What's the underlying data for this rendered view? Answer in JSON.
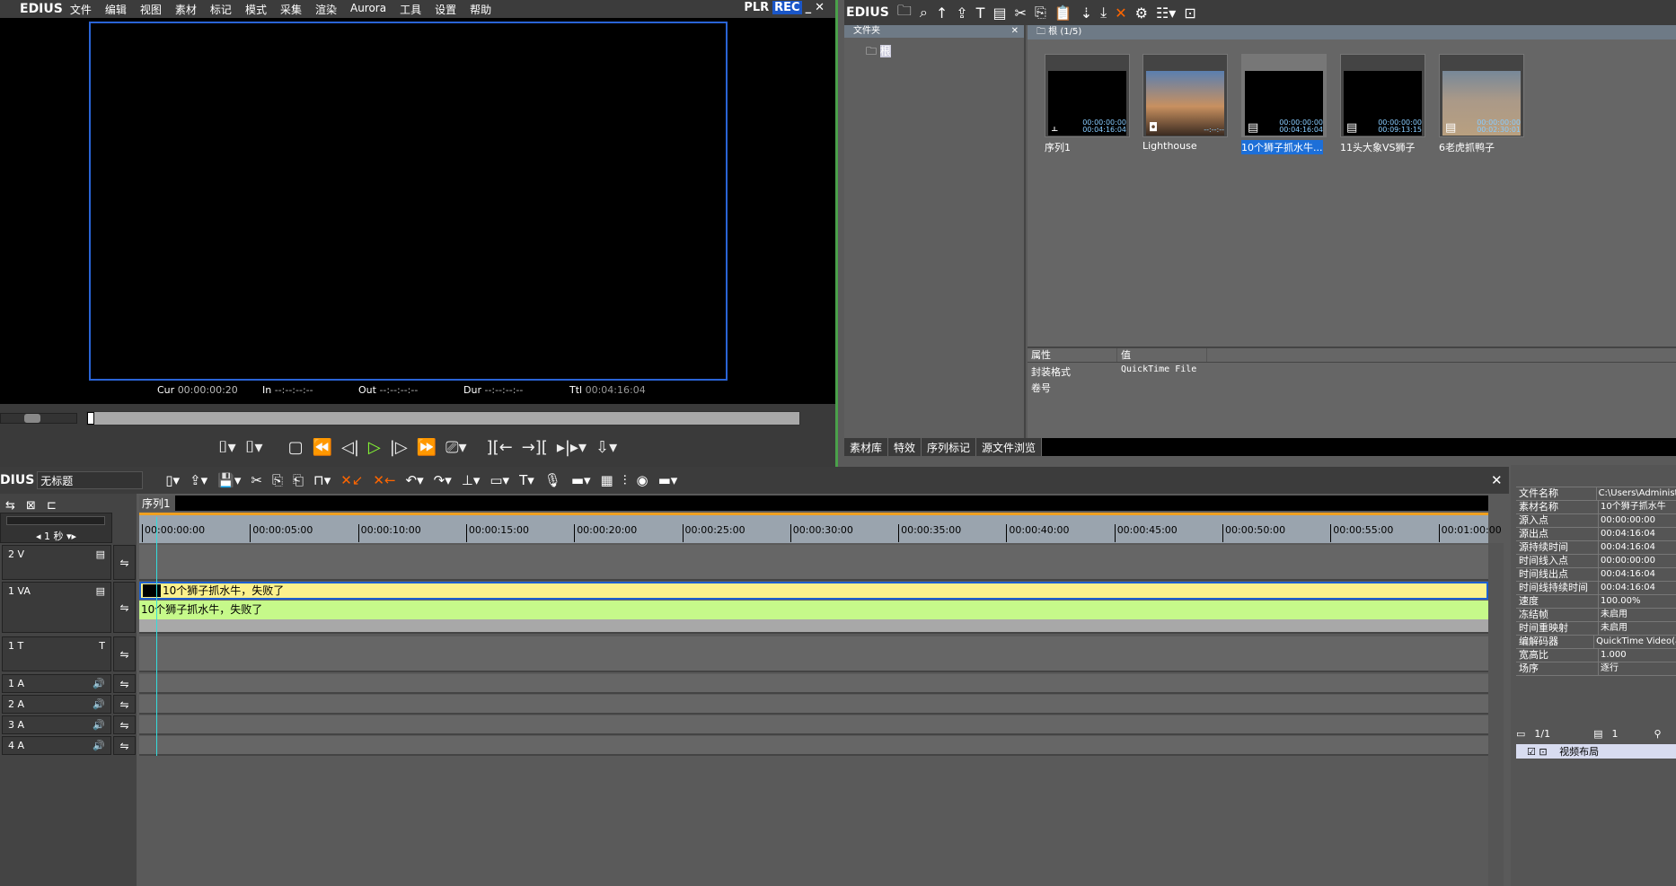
{
  "menu": {
    "logo": "EDIUS",
    "items": [
      "文件",
      "编辑",
      "视图",
      "素材",
      "标记",
      "模式",
      "采集",
      "渲染",
      "Aurora",
      "工具",
      "设置",
      "帮助"
    ],
    "plr": "PLR",
    "rec": "REC"
  },
  "player": {
    "cur_label": "Cur",
    "cur": "00:00:00:20",
    "in_label": "In",
    "in": "--:--:--:--",
    "out_label": "Out",
    "out": "--:--:--:--",
    "dur_label": "Dur",
    "dur": "--:--:--:--",
    "ttl_label": "Ttl",
    "ttl": "00:04:16:04"
  },
  "bin": {
    "logo": "EDIUS",
    "folder_title": "文件夹",
    "root": "根",
    "header": "根 (1/5)",
    "clips": [
      {
        "name": "序列1",
        "in": "00:00:00:00",
        "dur": "00:04:16:04",
        "icon": "sequence-icon"
      },
      {
        "name": "Lighthouse",
        "in": "",
        "dur": "--:--:--",
        "icon": "still-image-icon"
      },
      {
        "name": "10个狮子抓水牛...",
        "in": "00:00:00:00",
        "dur": "00:04:16:04",
        "icon": "film-icon",
        "selected": true
      },
      {
        "name": "11头大象VS狮子",
        "in": "00:00:00:00",
        "dur": "00:09:13:15",
        "icon": "film-icon"
      },
      {
        "name": "6老虎抓鸭子",
        "in": "00:00:00:00",
        "dur": "00:02:30:01",
        "icon": "film-icon"
      }
    ],
    "props_header": [
      "属性",
      "值"
    ],
    "props": [
      [
        "封装格式",
        "QuickTime File"
      ],
      [
        "卷号",
        ""
      ]
    ],
    "tabs": [
      "素材库",
      "特效",
      "序列标记",
      "源文件浏览"
    ]
  },
  "timeline": {
    "logo": "DIUS",
    "project": "无标题",
    "sequence_tab": "序列1",
    "scale": "1 秒",
    "ruler": [
      "00:00:00:00",
      "00:00:05:00",
      "00:00:10:00",
      "00:00:15:00",
      "00:00:20:00",
      "00:00:25:00",
      "00:00:30:00",
      "00:00:35:00",
      "00:00:40:00",
      "00:00:45:00",
      "00:00:50:00",
      "00:00:55:00",
      "00:01:00:00"
    ],
    "tracks": [
      "2 V",
      "1 VA",
      "1 T",
      "1 A",
      "2 A",
      "3 A",
      "4 A"
    ],
    "video_clip": "10个狮子抓水牛，失败了",
    "audio_clip": "10个狮子抓水牛，失败了"
  },
  "info": {
    "rows": [
      [
        "文件名称",
        "C:\\Users\\Administ"
      ],
      [
        "素材名称",
        "10个狮子抓水牛"
      ],
      [
        "源入点",
        "00:00:00:00"
      ],
      [
        "源出点",
        "00:04:16:04"
      ],
      [
        "源持续时间",
        "00:04:16:04"
      ],
      [
        "时间线入点",
        "00:00:00:00"
      ],
      [
        "时间线出点",
        "00:04:16:04"
      ],
      [
        "时间线持续时间",
        "00:04:16:04"
      ],
      [
        "速度",
        "100.00%"
      ],
      [
        "冻结帧",
        "未启用"
      ],
      [
        "时间重映射",
        "未启用"
      ],
      [
        "编解码器",
        "QuickTime Video(a"
      ],
      [
        "宽高比",
        "1.000"
      ],
      [
        "场序",
        "逐行"
      ]
    ],
    "page": "1/1",
    "layer_count": "1",
    "effect": "视频布局"
  }
}
